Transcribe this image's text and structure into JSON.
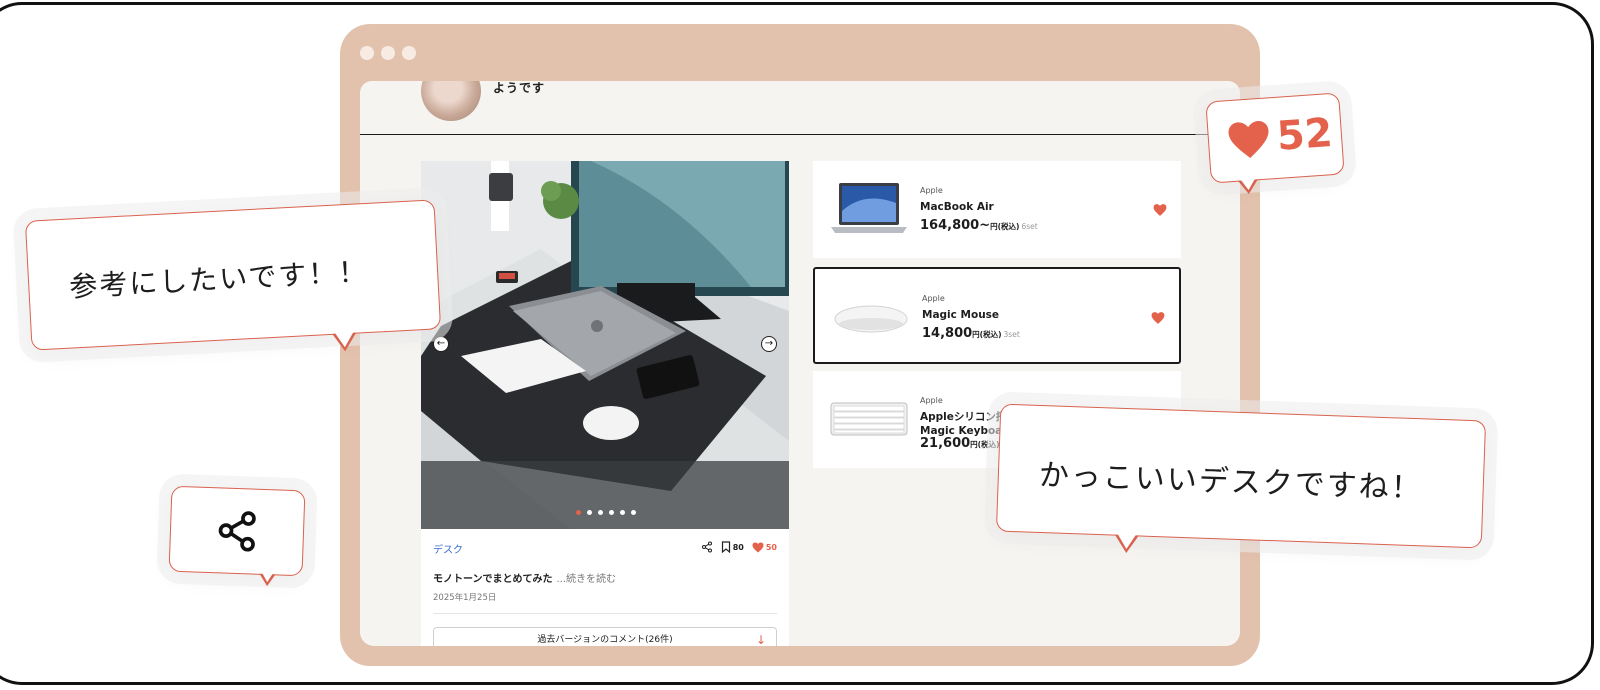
{
  "window": {
    "controls": [
      "close",
      "minimize",
      "maximize"
    ]
  },
  "profile": {
    "greeting": "ようです"
  },
  "post": {
    "tag": "デスク",
    "share_icon": "share-icon",
    "bookmark_count": "80",
    "like_count": "50",
    "title": "モノトーンでまとめてみた",
    "read_more": "...続きを読む",
    "date": "2025年1月25日",
    "comments_button": "過去バージョンのコメント(26件)",
    "carousel": {
      "total": 6,
      "current": 1
    }
  },
  "products": [
    {
      "brand": "Apple",
      "name": "MacBook Air",
      "price": "164,800~",
      "unit": "円(税込)",
      "sets": "6set",
      "selected": false,
      "icon": "laptop-icon"
    },
    {
      "brand": "Apple",
      "name": "Magic Mouse",
      "price": "14,800",
      "unit": "円(税込)",
      "sets": "3set",
      "selected": true,
      "icon": "mouse-icon"
    },
    {
      "brand": "Apple",
      "name": "Appleシリコン搭",
      "name2": "Magic Keyboard",
      "price": "21,600",
      "unit": "円(税込)",
      "sets": "",
      "selected": false,
      "icon": "keyboard-icon"
    }
  ],
  "bubbles": {
    "left": "参考にしたいです！！",
    "right": "かっこいいデスクですね！",
    "likes": "52",
    "share_icon": "share-icon"
  },
  "colors": {
    "accent": "#e4614b",
    "browser_frame": "#e2c2ad",
    "screen_bg": "#f6f4f1"
  }
}
